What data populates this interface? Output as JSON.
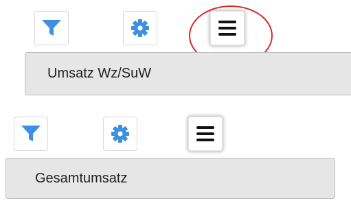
{
  "colors": {
    "accent": "#3d8fe0",
    "menu_icon": "#111111",
    "bar_background": "#e6e6e6",
    "highlight_ring": "#d62828"
  },
  "panels": [
    {
      "label": "Umsatz Wz/SuW",
      "icons": [
        "filter-icon",
        "gear-icon",
        "hamburger-menu-icon"
      ],
      "highlighted_icon": "hamburger-menu-icon"
    },
    {
      "label": "Gesamtumsatz",
      "icons": [
        "filter-icon",
        "gear-icon",
        "hamburger-menu-icon"
      ]
    }
  ]
}
